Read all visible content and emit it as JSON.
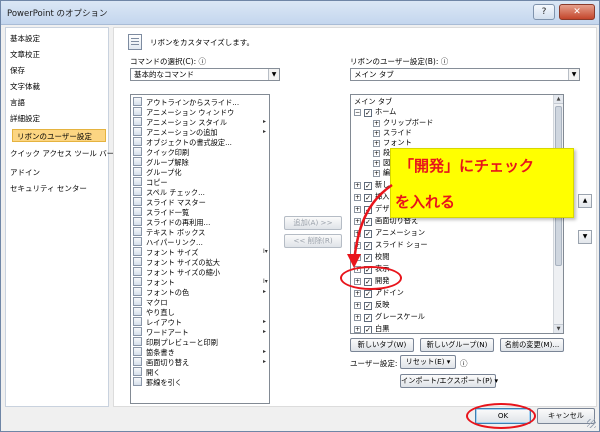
{
  "window": {
    "title": "PowerPoint のオプション",
    "help_glyph": "?",
    "close_glyph": "✕"
  },
  "nav": {
    "items": [
      {
        "label": "基本設定"
      },
      {
        "label": "文章校正"
      },
      {
        "label": "保存"
      },
      {
        "label": "文字体裁"
      },
      {
        "label": "言語"
      },
      {
        "label": "詳細設定"
      },
      {
        "label": "リボンのユーザー設定",
        "selected": true
      },
      {
        "label": "クイック アクセス ツール バー"
      },
      {
        "label": "アドイン"
      },
      {
        "label": "セキュリティ センター"
      }
    ]
  },
  "header": {
    "text": "リボンをカスタマイズします。"
  },
  "commands": {
    "label": "コマンドの選択(C):",
    "info": "ⓘ",
    "selected": "基本的なコマンド",
    "items": [
      {
        "label": "アウトラインからスライド..."
      },
      {
        "label": "アニメーション ウィンドウ"
      },
      {
        "label": "アニメーション スタイル",
        "sub": "▸"
      },
      {
        "label": "アニメーションの追加",
        "sub": "▸"
      },
      {
        "label": "オブジェクトの書式設定..."
      },
      {
        "label": "クイック印刷"
      },
      {
        "label": "グループ解除"
      },
      {
        "label": "グループ化"
      },
      {
        "label": "コピー"
      },
      {
        "label": "スペル チェック..."
      },
      {
        "label": "スライド マスター"
      },
      {
        "label": "スライド一覧"
      },
      {
        "label": "スライドの再利用..."
      },
      {
        "label": "テキスト ボックス"
      },
      {
        "label": "ハイパーリンク..."
      },
      {
        "label": "フォント サイズ",
        "sub": "I▾"
      },
      {
        "label": "フォント サイズの拡大"
      },
      {
        "label": "フォント サイズの縮小"
      },
      {
        "label": "フォント",
        "sub": "I▾"
      },
      {
        "label": "フォントの色",
        "sub": "▸"
      },
      {
        "label": "マクロ"
      },
      {
        "label": "やり直し"
      },
      {
        "label": "レイアウト",
        "sub": "▸"
      },
      {
        "label": "ワードアート",
        "sub": "▸"
      },
      {
        "label": "印刷プレビューと印刷"
      },
      {
        "label": "箇条書き",
        "sub": "▸"
      },
      {
        "label": "画面切り替え",
        "sub": "▸"
      },
      {
        "label": "開く"
      },
      {
        "label": "罫線を引く"
      }
    ]
  },
  "buttons": {
    "add": "追加(A) >>",
    "remove": "<< 削除(R)",
    "new_tab": "新しいタブ(W)",
    "new_group": "新しいグループ(N)",
    "rename": "名前の変更(M)...",
    "reset": "リセット(E) ▾",
    "import_export": "インポート/エクスポート(P) ▾",
    "ok": "OK",
    "cancel": "キャンセル"
  },
  "ribbon": {
    "label": "リボンのユーザー設定(B):",
    "info": "ⓘ",
    "selected": "メイン タブ",
    "tree_header": "メイン タブ",
    "home": "ホーム",
    "home_groups": [
      "クリップボード",
      "スライド",
      "フォント",
      "段落",
      "図",
      "編集"
    ],
    "tabs": [
      {
        "label": "新しい"
      },
      {
        "label": "挿入"
      },
      {
        "label": "デザイン"
      },
      {
        "label": "画面切り替え"
      },
      {
        "label": "アニメーション"
      },
      {
        "label": "スライド ショー"
      },
      {
        "label": "校閲"
      },
      {
        "label": "表示"
      },
      {
        "label": "開発",
        "highlight": true
      },
      {
        "label": "アドイン"
      },
      {
        "label": "反映"
      },
      {
        "label": "グレースケール"
      },
      {
        "label": "白黒"
      }
    ],
    "user_settings_label": "ユーザー設定:",
    "info2": "ⓘ"
  },
  "callout": {
    "line1": "「開発」にチェック",
    "line2": "を入れる"
  },
  "colors": {
    "annotation_red": "#e8141b",
    "callout_yellow": "#ffff00",
    "selected_nav": "#fcd582"
  }
}
